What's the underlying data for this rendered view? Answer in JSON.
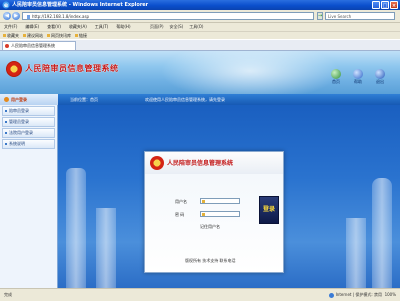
{
  "browser": {
    "title": "人民陪审员信息管理系统 - Windows Internet Explorer",
    "address": "http://192.168.1.8/index.asp",
    "search_placeholder": "Live Search",
    "menu": [
      "文件(F)",
      "编辑(E)",
      "查看(V)",
      "收藏夹(A)",
      "工具(T)",
      "帮助(H)"
    ],
    "toolbar": [
      "页面(P)",
      "安全(S)",
      "工具(O)"
    ],
    "links": [
      "收藏夹",
      "建议网站",
      "网页快讯库",
      "链接"
    ],
    "tab_label": "人民陪审员信息管理系统"
  },
  "site": {
    "title": "人民陪审员信息管理系统",
    "top_icons": [
      {
        "label": "首页",
        "icon": "home-icon"
      },
      {
        "label": "帮助",
        "icon": "help-icon"
      },
      {
        "label": "退出",
        "icon": "exit-icon"
      }
    ],
    "section_label": "用户登录",
    "breadcrumb": "当前位置：首页",
    "notice": "欢迎使用人民陪审员信息管理系统，请先登录"
  },
  "sidebar": {
    "items": [
      {
        "label": "陪审员登录"
      },
      {
        "label": "管理员登录"
      },
      {
        "label": "法院用户登录"
      },
      {
        "label": "系统说明"
      }
    ]
  },
  "login": {
    "title": "人民陪审员信息管理系统",
    "username_label": "用户名",
    "password_label": "密  码",
    "username_value": "",
    "password_value": "",
    "button_label": "登录",
    "remember_label": "记住用户名",
    "footnote": "版权所有  技术支持  联系电话"
  },
  "status": {
    "left": "完成",
    "right": "Internet | 保护模式: 禁用",
    "zoom": "100%"
  },
  "colors": {
    "title_red": "#c41a1a",
    "banner_blue": "#6fb0e3",
    "main_blue": "#2a73cf"
  }
}
